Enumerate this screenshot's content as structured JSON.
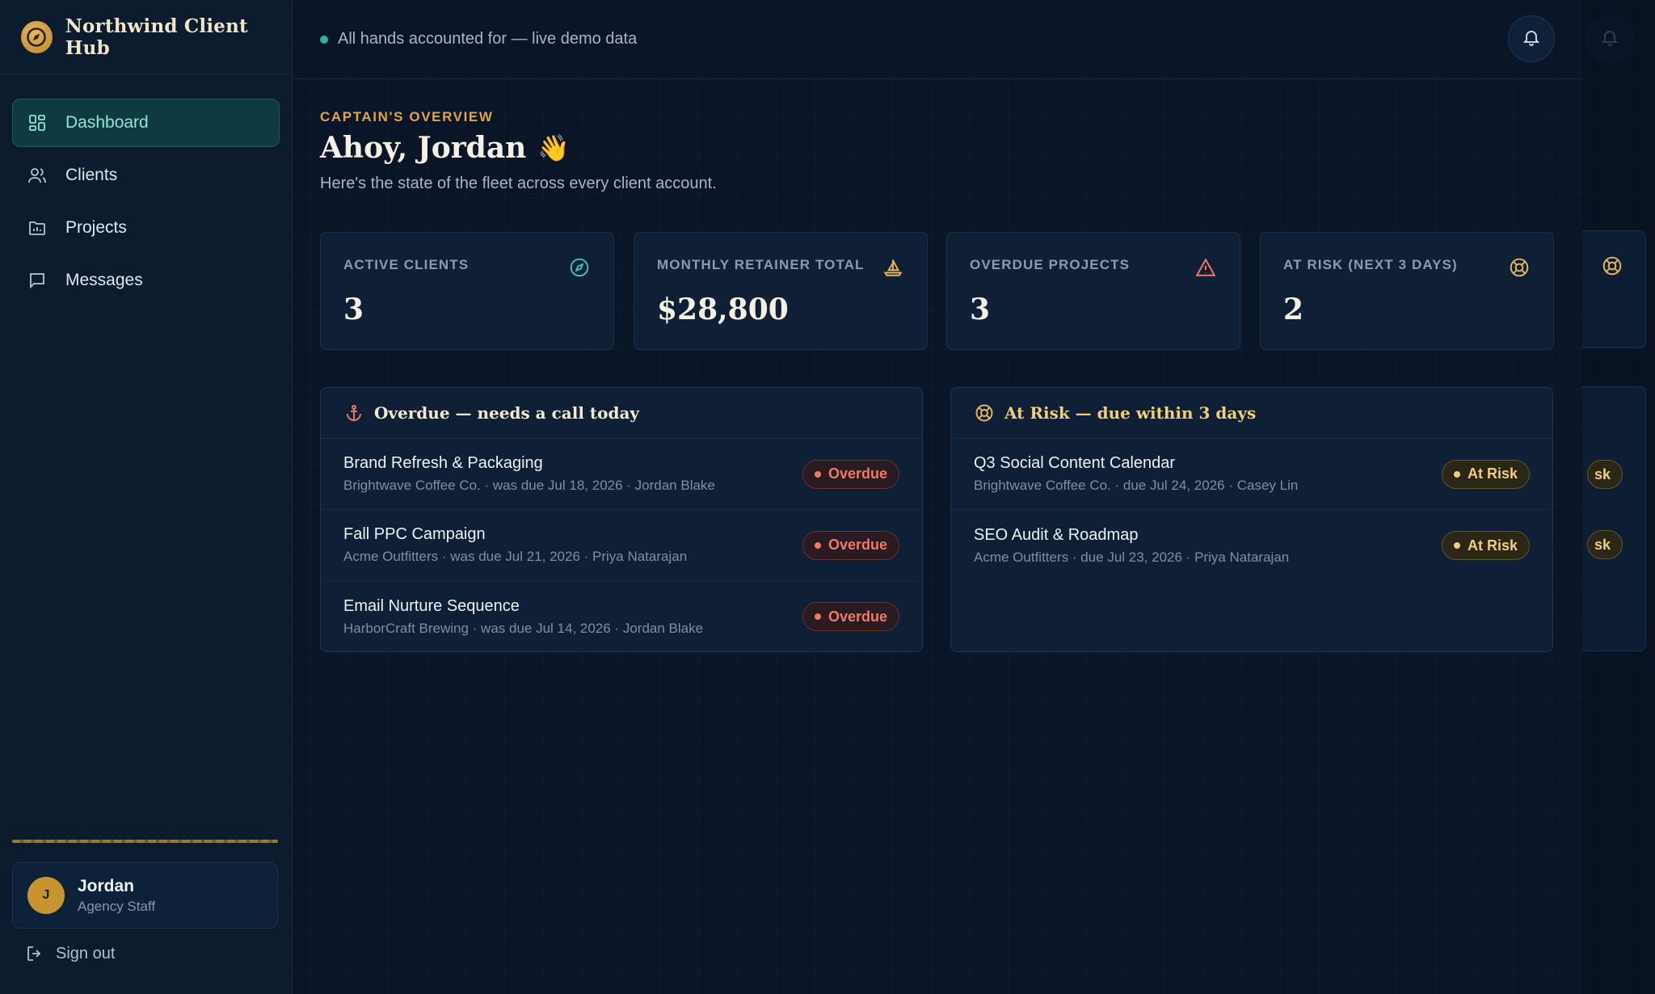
{
  "app": {
    "title": "Northwind Client Hub",
    "status": "All hands accounted for — live demo data"
  },
  "sidebar": {
    "items": [
      {
        "label": "Dashboard",
        "icon": "dashboard-icon",
        "active": true
      },
      {
        "label": "Clients",
        "icon": "users-icon"
      },
      {
        "label": "Projects",
        "icon": "folder-icon"
      },
      {
        "label": "Messages",
        "icon": "message-icon"
      }
    ],
    "user": {
      "initial": "J",
      "name": "Jordan",
      "role": "Agency Staff"
    },
    "signout_label": "Sign out"
  },
  "header": {
    "eyebrow": "CAPTAIN'S OVERVIEW",
    "greeting": "Ahoy, Jordan",
    "wave": "👋",
    "subtitle": "Here's the state of the fleet across every client account."
  },
  "stats": [
    {
      "label": "ACTIVE CLIENTS",
      "value": "3",
      "icon": "compass-icon"
    },
    {
      "label": "MONTHLY RETAINER TOTAL",
      "value": "$28,800",
      "icon": "sailboat-icon"
    },
    {
      "label": "OVERDUE PROJECTS",
      "value": "3",
      "icon": "warning-icon"
    },
    {
      "label": "AT RISK (NEXT 3 DAYS)",
      "value": "2",
      "icon": "lifebuoy-icon"
    }
  ],
  "overdue": {
    "title": "Overdue — needs a call today",
    "icon": "anchor-icon",
    "rows": [
      {
        "title": "Brand Refresh & Packaging",
        "meta": "Brightwave Coffee Co. · was due Jul 18, 2026 · Jordan Blake",
        "badge": "Overdue"
      },
      {
        "title": "Fall PPC Campaign",
        "meta": "Acme Outfitters · was due Jul 21, 2026 · Priya Natarajan",
        "badge": "Overdue"
      },
      {
        "title": "Email Nurture Sequence",
        "meta": "HarborCraft Brewing · was due Jul 14, 2026 · Jordan Blake",
        "badge": "Overdue"
      }
    ]
  },
  "at_risk": {
    "title": "At Risk — due within 3 days",
    "icon": "lifebuoy-icon",
    "rows": [
      {
        "title": "Q3 Social Content Calendar",
        "meta": "Brightwave Coffee Co. · due Jul 24, 2026 · Casey Lin",
        "badge": "At Risk"
      },
      {
        "title": "SEO Audit & Roadmap",
        "meta": "Acme Outfitters · due Jul 23, 2026 · Priya Natarajan",
        "badge": "At Risk"
      }
    ]
  },
  "ghost": {
    "badge_fragment": "sk"
  },
  "colors": {
    "background": "#0a1628",
    "accent_teal": "#2bb59c",
    "accent_gold": "#e0a54a",
    "overdue_red": "#f07a63",
    "risk_yellow": "#f0cf7c"
  }
}
